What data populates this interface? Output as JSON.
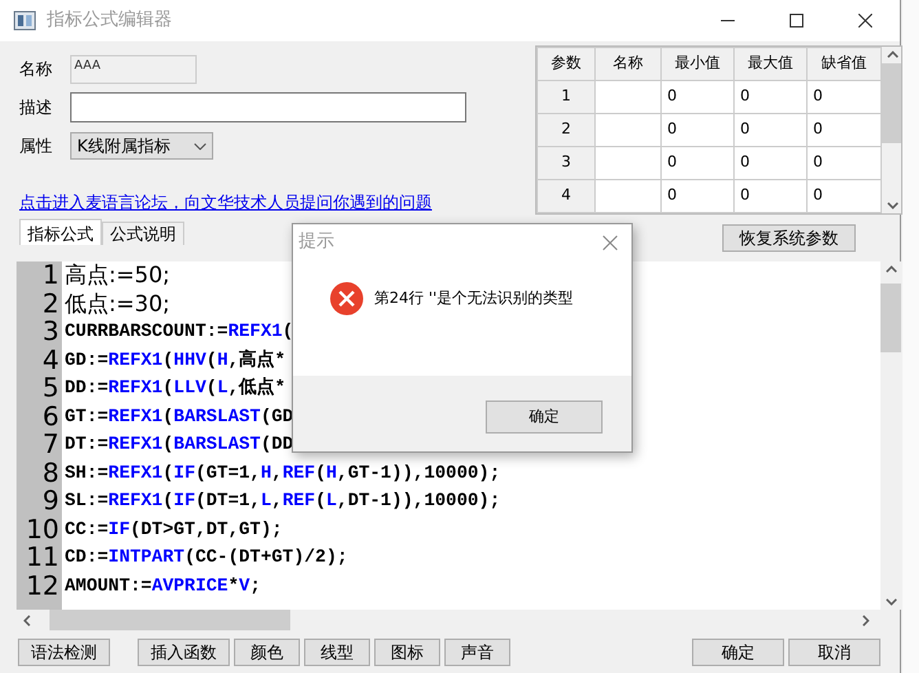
{
  "window": {
    "title": "指标公式编辑器"
  },
  "form": {
    "name_label": "名称",
    "name_value": "AAA",
    "desc_label": "描述",
    "attr_label": "属性",
    "attr_value": "K线附属指标"
  },
  "forum_link": "点击进入麦语言论坛，向文华技术人员提问你遇到的问题",
  "tabs": [
    {
      "label": "指标公式",
      "selected": true
    },
    {
      "label": "公式说明",
      "selected": false
    }
  ],
  "params_table": {
    "columns": [
      "参数",
      "名称",
      "最小值",
      "最大值",
      "缺省值"
    ],
    "rows": [
      [
        "1",
        "",
        "0",
        "0",
        "0"
      ],
      [
        "2",
        "",
        "0",
        "0",
        "0"
      ],
      [
        "3",
        "",
        "0",
        "0",
        "0"
      ],
      [
        "4",
        "",
        "0",
        "0",
        "0"
      ]
    ]
  },
  "restore_button": "恢复系统参数",
  "code_lines": [
    {
      "number": "1",
      "segments": [
        {
          "kind": "cjk",
          "text": "高点:=50;"
        }
      ]
    },
    {
      "number": "2",
      "segments": [
        {
          "kind": "cjk",
          "text": "低点:=30;"
        }
      ]
    },
    {
      "number": "3",
      "segments": [
        {
          "kind": "plain",
          "text": "CURRBARSCOUNT:="
        },
        {
          "kind": "func",
          "text": "REFX1"
        },
        {
          "kind": "plain",
          "text": "("
        }
      ]
    },
    {
      "number": "4",
      "segments": [
        {
          "kind": "plain",
          "text": "GD:="
        },
        {
          "kind": "func",
          "text": "REFX1"
        },
        {
          "kind": "plain",
          "text": "("
        },
        {
          "kind": "func",
          "text": "HHV"
        },
        {
          "kind": "plain",
          "text": "("
        },
        {
          "kind": "func",
          "text": "H"
        },
        {
          "kind": "plain",
          "text": ",高点*"
        }
      ]
    },
    {
      "number": "5",
      "segments": [
        {
          "kind": "plain",
          "text": "DD:="
        },
        {
          "kind": "func",
          "text": "REFX1"
        },
        {
          "kind": "plain",
          "text": "("
        },
        {
          "kind": "func",
          "text": "LLV"
        },
        {
          "kind": "plain",
          "text": "("
        },
        {
          "kind": "func",
          "text": "L"
        },
        {
          "kind": "plain",
          "text": ",低点*"
        }
      ]
    },
    {
      "number": "6",
      "segments": [
        {
          "kind": "plain",
          "text": "GT:="
        },
        {
          "kind": "func",
          "text": "REFX1"
        },
        {
          "kind": "plain",
          "text": "("
        },
        {
          "kind": "func",
          "text": "BARSLAST"
        },
        {
          "kind": "plain",
          "text": "(GD"
        }
      ]
    },
    {
      "number": "7",
      "segments": [
        {
          "kind": "plain",
          "text": "DT:="
        },
        {
          "kind": "func",
          "text": "REFX1"
        },
        {
          "kind": "plain",
          "text": "("
        },
        {
          "kind": "func",
          "text": "BARSLAST"
        },
        {
          "kind": "plain",
          "text": "(DD"
        }
      ]
    },
    {
      "number": "8",
      "segments": [
        {
          "kind": "plain",
          "text": "SH:="
        },
        {
          "kind": "func",
          "text": "REFX1"
        },
        {
          "kind": "plain",
          "text": "("
        },
        {
          "kind": "func",
          "text": "IF"
        },
        {
          "kind": "plain",
          "text": "(GT=1,"
        },
        {
          "kind": "func",
          "text": "H"
        },
        {
          "kind": "plain",
          "text": ","
        },
        {
          "kind": "func",
          "text": "REF"
        },
        {
          "kind": "plain",
          "text": "("
        },
        {
          "kind": "func",
          "text": "H"
        },
        {
          "kind": "plain",
          "text": ",GT-1)),10000);"
        }
      ]
    },
    {
      "number": "9",
      "segments": [
        {
          "kind": "plain",
          "text": "SL:="
        },
        {
          "kind": "func",
          "text": "REFX1"
        },
        {
          "kind": "plain",
          "text": "("
        },
        {
          "kind": "func",
          "text": "IF"
        },
        {
          "kind": "plain",
          "text": "(DT=1,"
        },
        {
          "kind": "func",
          "text": "L"
        },
        {
          "kind": "plain",
          "text": ","
        },
        {
          "kind": "func",
          "text": "REF"
        },
        {
          "kind": "plain",
          "text": "("
        },
        {
          "kind": "func",
          "text": "L"
        },
        {
          "kind": "plain",
          "text": ",DT-1)),10000);"
        }
      ]
    },
    {
      "number": "10",
      "segments": [
        {
          "kind": "plain",
          "text": "CC:="
        },
        {
          "kind": "func",
          "text": "IF"
        },
        {
          "kind": "plain",
          "text": "(DT>GT,DT,GT);"
        }
      ]
    },
    {
      "number": "11",
      "segments": [
        {
          "kind": "plain",
          "text": "CD:="
        },
        {
          "kind": "func",
          "text": "INTPART"
        },
        {
          "kind": "plain",
          "text": "(CC-(DT+GT)/2);"
        }
      ]
    },
    {
      "number": "12",
      "segments": [
        {
          "kind": "plain",
          "text": "AMOUNT:="
        },
        {
          "kind": "func",
          "text": "AVPRICE"
        },
        {
          "kind": "plain",
          "text": "*"
        },
        {
          "kind": "func",
          "text": "V"
        },
        {
          "kind": "plain",
          "text": ";"
        }
      ]
    }
  ],
  "bottom_buttons": {
    "left": [
      "语法检测"
    ],
    "middle": [
      "插入函数",
      "颜色",
      "线型",
      "图标",
      "声音"
    ],
    "right": [
      "确定",
      "取消"
    ]
  },
  "dialog": {
    "title": "提示",
    "message": "第24行 ''是个无法识别的类型",
    "button": "确定"
  }
}
